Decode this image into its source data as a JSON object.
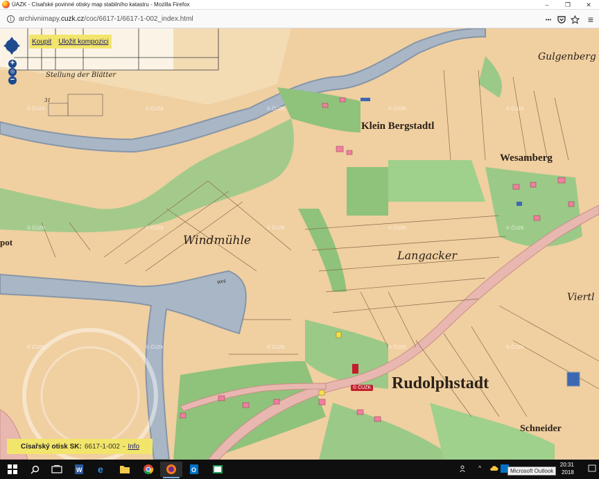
{
  "window": {
    "title": "ÚAZK - Císařské povinné otisky map stabilního katastru - Mozilla Firefox",
    "minimize": "–",
    "restore": "❐",
    "close": "✕"
  },
  "browser": {
    "url_prefix": "archivnimapy.",
    "url_domain": "cuzk.cz",
    "url_path": "/coc/6617-1/6617-1-002_index.html",
    "more_icon": "•••",
    "menu_icon": "≡"
  },
  "map": {
    "links": {
      "buy": "Koupit",
      "save": "Uložit kompozici"
    },
    "zoom_in": "+",
    "zoom_out": "−",
    "labels": {
      "stellung": "Stellung der Blätter",
      "sheet_number": "31",
      "klein_bergstadtl": "Klein Bergstadtl",
      "wesamberg": "Wesamberg",
      "gulgenberg": "Gulgenberg",
      "windmuhle": "Windmühle",
      "langacker": "Langacker",
      "rudolphstadt": "Rudolphstadt",
      "schneider": "Schneider",
      "viertl": "Viertl",
      "pot": "pot",
      "weg": "Weg"
    },
    "watermark": "© ČÚZK",
    "stamp_label": "© ČÚZK",
    "info": {
      "label": "Císařský otisk SK:",
      "sheet": "6617-1-002",
      "separator": "-",
      "link": "Info"
    }
  },
  "taskbar": {
    "start_icon": "windows-start-icon",
    "time": "20:31",
    "date": "2018",
    "tooltip": "Microsoft Outlook"
  },
  "colors": {
    "parchment": "#f0cfa1",
    "meadow": "#93c47d",
    "river": "#a7b7c9",
    "road": "#e8b7b0",
    "button_yellow": "#f2e56b"
  }
}
